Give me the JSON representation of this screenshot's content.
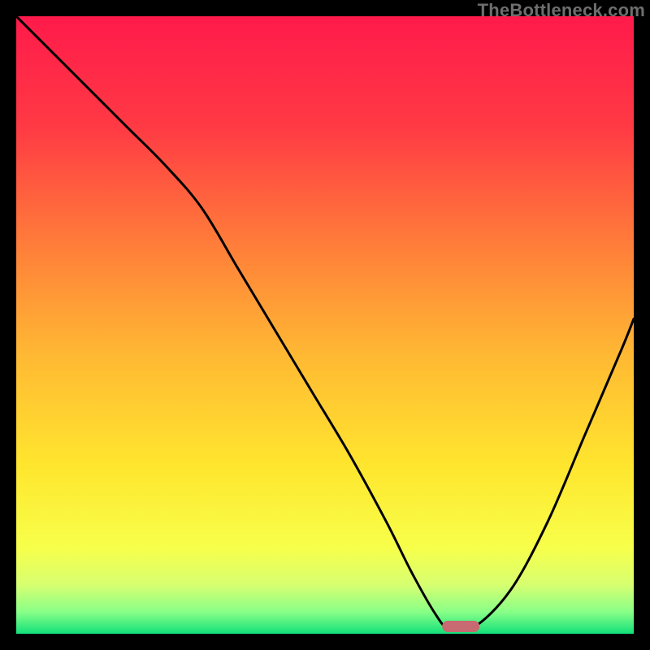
{
  "watermark": "TheBottleneck.com",
  "colors": {
    "black": "#000000",
    "curve": "#000000",
    "marker": "#c76a71",
    "gradient_stops": [
      {
        "offset": 0.0,
        "color": "#ff1a4b"
      },
      {
        "offset": 0.18,
        "color": "#ff3a44"
      },
      {
        "offset": 0.36,
        "color": "#ff7a3a"
      },
      {
        "offset": 0.55,
        "color": "#ffb933"
      },
      {
        "offset": 0.73,
        "color": "#ffe62e"
      },
      {
        "offset": 0.86,
        "color": "#f7ff4a"
      },
      {
        "offset": 0.92,
        "color": "#d8ff70"
      },
      {
        "offset": 0.965,
        "color": "#88ff88"
      },
      {
        "offset": 1.0,
        "color": "#12e07a"
      }
    ]
  },
  "chart_data": {
    "type": "line",
    "title": "",
    "xlabel": "",
    "ylabel": "",
    "xlim": [
      0,
      100
    ],
    "ylim": [
      0,
      100
    ],
    "x": [
      0,
      6,
      12,
      18,
      24,
      30,
      36,
      42,
      48,
      54,
      60,
      64,
      68,
      70,
      74,
      80,
      86,
      92,
      98,
      100
    ],
    "values": [
      100,
      94,
      88,
      82,
      76,
      69,
      59,
      49,
      39,
      29,
      18,
      10,
      3,
      1,
      1,
      7,
      18,
      32,
      46,
      51
    ],
    "minimum_x": 72,
    "minimum_width_pct": 6
  }
}
